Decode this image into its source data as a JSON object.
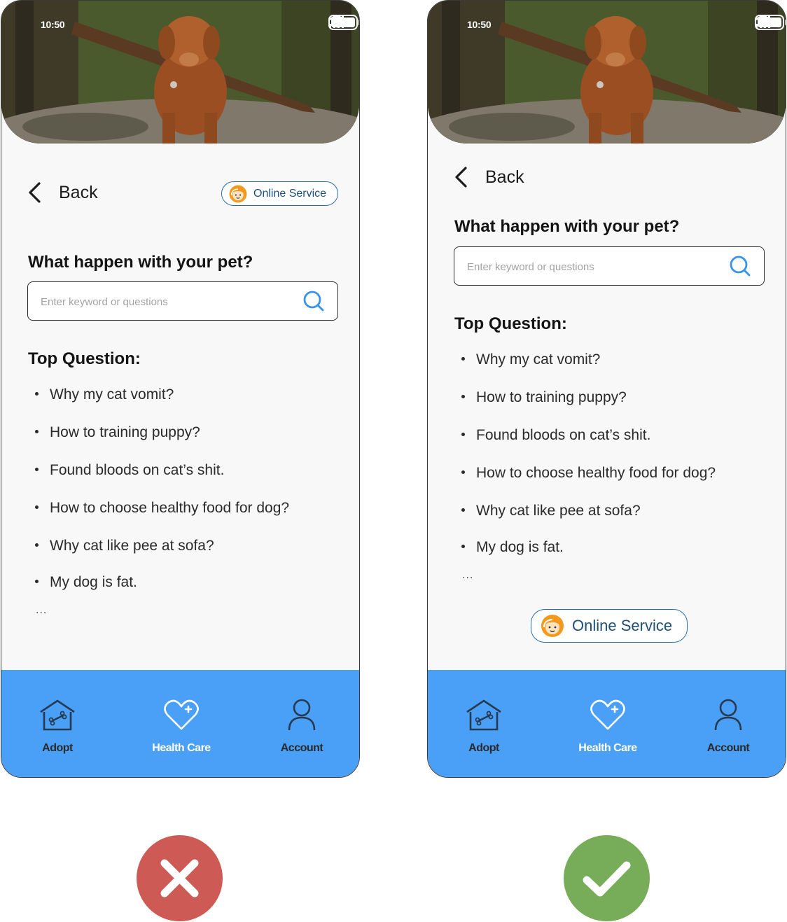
{
  "status_bar": {
    "time": "10:50"
  },
  "header": {
    "back_label": "Back",
    "online_service_label": "Online Service"
  },
  "search": {
    "heading": "What happen with your pet?",
    "placeholder": "Enter keyword or questions"
  },
  "top_questions": {
    "heading": "Top Question:",
    "items": [
      "Why my cat vomit?",
      "How to training puppy?",
      "Found bloods on cat’s shit.",
      "How to choose healthy food for dog?",
      "Why cat like pee at sofa?",
      "My dog is fat."
    ],
    "more": "..."
  },
  "tab_bar": {
    "items": [
      {
        "label": "Adopt",
        "icon": "house-bone-icon"
      },
      {
        "label": "Health Care",
        "icon": "heart-plus-icon"
      },
      {
        "label": "Account",
        "icon": "person-icon"
      }
    ],
    "colors": {
      "background": "#4a9ff7",
      "inactive_label": "#2a2a2a",
      "active_label": "#ffffff"
    }
  },
  "verdicts": {
    "left": {
      "icon": "cross-icon",
      "color": "#cd5a55"
    },
    "right": {
      "icon": "check-icon",
      "color": "#77ad58"
    }
  }
}
